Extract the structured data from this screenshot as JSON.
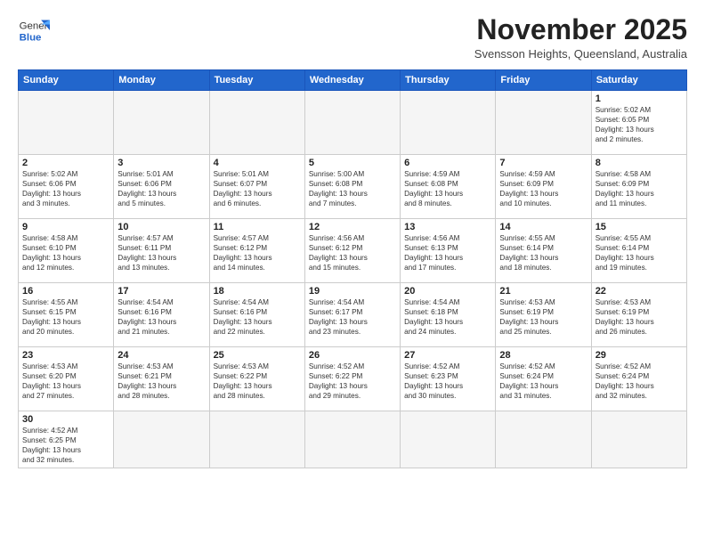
{
  "logo": {
    "line1": "General",
    "line2": "Blue"
  },
  "title": "November 2025",
  "subtitle": "Svensson Heights, Queensland, Australia",
  "days_of_week": [
    "Sunday",
    "Monday",
    "Tuesday",
    "Wednesday",
    "Thursday",
    "Friday",
    "Saturday"
  ],
  "weeks": [
    [
      {
        "day": "",
        "info": ""
      },
      {
        "day": "",
        "info": ""
      },
      {
        "day": "",
        "info": ""
      },
      {
        "day": "",
        "info": ""
      },
      {
        "day": "",
        "info": ""
      },
      {
        "day": "",
        "info": ""
      },
      {
        "day": "1",
        "info": "Sunrise: 5:02 AM\nSunset: 6:05 PM\nDaylight: 13 hours\nand 2 minutes."
      }
    ],
    [
      {
        "day": "2",
        "info": "Sunrise: 5:02 AM\nSunset: 6:06 PM\nDaylight: 13 hours\nand 3 minutes."
      },
      {
        "day": "3",
        "info": "Sunrise: 5:01 AM\nSunset: 6:06 PM\nDaylight: 13 hours\nand 5 minutes."
      },
      {
        "day": "4",
        "info": "Sunrise: 5:01 AM\nSunset: 6:07 PM\nDaylight: 13 hours\nand 6 minutes."
      },
      {
        "day": "5",
        "info": "Sunrise: 5:00 AM\nSunset: 6:08 PM\nDaylight: 13 hours\nand 7 minutes."
      },
      {
        "day": "6",
        "info": "Sunrise: 4:59 AM\nSunset: 6:08 PM\nDaylight: 13 hours\nand 8 minutes."
      },
      {
        "day": "7",
        "info": "Sunrise: 4:59 AM\nSunset: 6:09 PM\nDaylight: 13 hours\nand 10 minutes."
      },
      {
        "day": "8",
        "info": "Sunrise: 4:58 AM\nSunset: 6:09 PM\nDaylight: 13 hours\nand 11 minutes."
      }
    ],
    [
      {
        "day": "9",
        "info": "Sunrise: 4:58 AM\nSunset: 6:10 PM\nDaylight: 13 hours\nand 12 minutes."
      },
      {
        "day": "10",
        "info": "Sunrise: 4:57 AM\nSunset: 6:11 PM\nDaylight: 13 hours\nand 13 minutes."
      },
      {
        "day": "11",
        "info": "Sunrise: 4:57 AM\nSunset: 6:12 PM\nDaylight: 13 hours\nand 14 minutes."
      },
      {
        "day": "12",
        "info": "Sunrise: 4:56 AM\nSunset: 6:12 PM\nDaylight: 13 hours\nand 15 minutes."
      },
      {
        "day": "13",
        "info": "Sunrise: 4:56 AM\nSunset: 6:13 PM\nDaylight: 13 hours\nand 17 minutes."
      },
      {
        "day": "14",
        "info": "Sunrise: 4:55 AM\nSunset: 6:14 PM\nDaylight: 13 hours\nand 18 minutes."
      },
      {
        "day": "15",
        "info": "Sunrise: 4:55 AM\nSunset: 6:14 PM\nDaylight: 13 hours\nand 19 minutes."
      }
    ],
    [
      {
        "day": "16",
        "info": "Sunrise: 4:55 AM\nSunset: 6:15 PM\nDaylight: 13 hours\nand 20 minutes."
      },
      {
        "day": "17",
        "info": "Sunrise: 4:54 AM\nSunset: 6:16 PM\nDaylight: 13 hours\nand 21 minutes."
      },
      {
        "day": "18",
        "info": "Sunrise: 4:54 AM\nSunset: 6:16 PM\nDaylight: 13 hours\nand 22 minutes."
      },
      {
        "day": "19",
        "info": "Sunrise: 4:54 AM\nSunset: 6:17 PM\nDaylight: 13 hours\nand 23 minutes."
      },
      {
        "day": "20",
        "info": "Sunrise: 4:54 AM\nSunset: 6:18 PM\nDaylight: 13 hours\nand 24 minutes."
      },
      {
        "day": "21",
        "info": "Sunrise: 4:53 AM\nSunset: 6:19 PM\nDaylight: 13 hours\nand 25 minutes."
      },
      {
        "day": "22",
        "info": "Sunrise: 4:53 AM\nSunset: 6:19 PM\nDaylight: 13 hours\nand 26 minutes."
      }
    ],
    [
      {
        "day": "23",
        "info": "Sunrise: 4:53 AM\nSunset: 6:20 PM\nDaylight: 13 hours\nand 27 minutes."
      },
      {
        "day": "24",
        "info": "Sunrise: 4:53 AM\nSunset: 6:21 PM\nDaylight: 13 hours\nand 28 minutes."
      },
      {
        "day": "25",
        "info": "Sunrise: 4:53 AM\nSunset: 6:22 PM\nDaylight: 13 hours\nand 28 minutes."
      },
      {
        "day": "26",
        "info": "Sunrise: 4:52 AM\nSunset: 6:22 PM\nDaylight: 13 hours\nand 29 minutes."
      },
      {
        "day": "27",
        "info": "Sunrise: 4:52 AM\nSunset: 6:23 PM\nDaylight: 13 hours\nand 30 minutes."
      },
      {
        "day": "28",
        "info": "Sunrise: 4:52 AM\nSunset: 6:24 PM\nDaylight: 13 hours\nand 31 minutes."
      },
      {
        "day": "29",
        "info": "Sunrise: 4:52 AM\nSunset: 6:24 PM\nDaylight: 13 hours\nand 32 minutes."
      }
    ],
    [
      {
        "day": "30",
        "info": "Sunrise: 4:52 AM\nSunset: 6:25 PM\nDaylight: 13 hours\nand 32 minutes."
      },
      {
        "day": "",
        "info": ""
      },
      {
        "day": "",
        "info": ""
      },
      {
        "day": "",
        "info": ""
      },
      {
        "day": "",
        "info": ""
      },
      {
        "day": "",
        "info": ""
      },
      {
        "day": "",
        "info": ""
      }
    ]
  ],
  "accent_color": "#2266cc"
}
